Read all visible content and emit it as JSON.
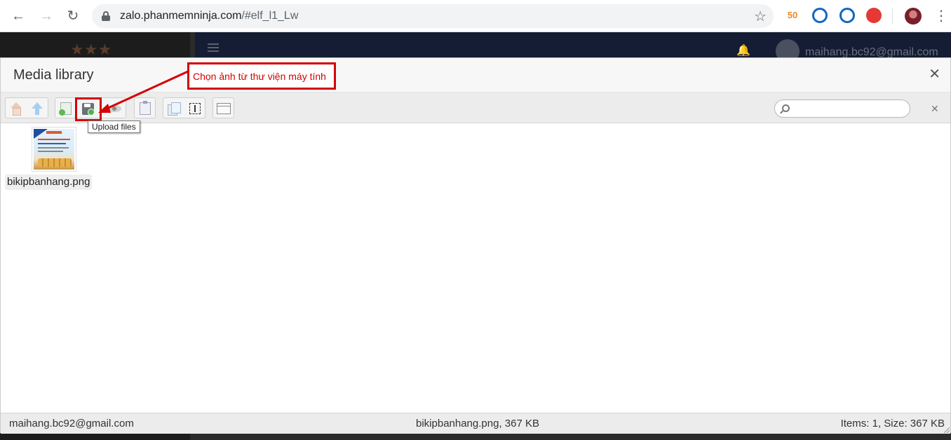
{
  "browser": {
    "url_host": "zalo.phanmemninja.com",
    "url_path": "/#elf_l1_Lw",
    "extensions": [
      {
        "name": "extension-50",
        "label": "50",
        "color": "#f08a24"
      },
      {
        "name": "extension-rocket-1",
        "label": "",
        "color": "#1565c0"
      },
      {
        "name": "extension-rocket-2",
        "label": "",
        "color": "#1565c0"
      },
      {
        "name": "extension-rocket-3",
        "label": "",
        "color": "#e53935"
      }
    ]
  },
  "background_page": {
    "user_email": "maihang.bc92@gmail.com"
  },
  "modal": {
    "title": "Media library",
    "toolbar": {
      "buttons": [
        "home",
        "up",
        "new-file",
        "upload",
        "preview",
        "paste",
        "copy",
        "select",
        "view"
      ],
      "upload_tooltip": "Upload files",
      "search_placeholder": ""
    },
    "files": [
      {
        "name": "bikipbanhang.png"
      }
    ],
    "status": {
      "left": "maihang.bc92@gmail.com",
      "center": "bikipbanhang.png, 367 KB",
      "right": "Items: 1, Size: 367 KB"
    }
  },
  "annotation": {
    "callout_text": "Chọn ảnh từ thư viện máy tính",
    "color": "#d40000"
  }
}
